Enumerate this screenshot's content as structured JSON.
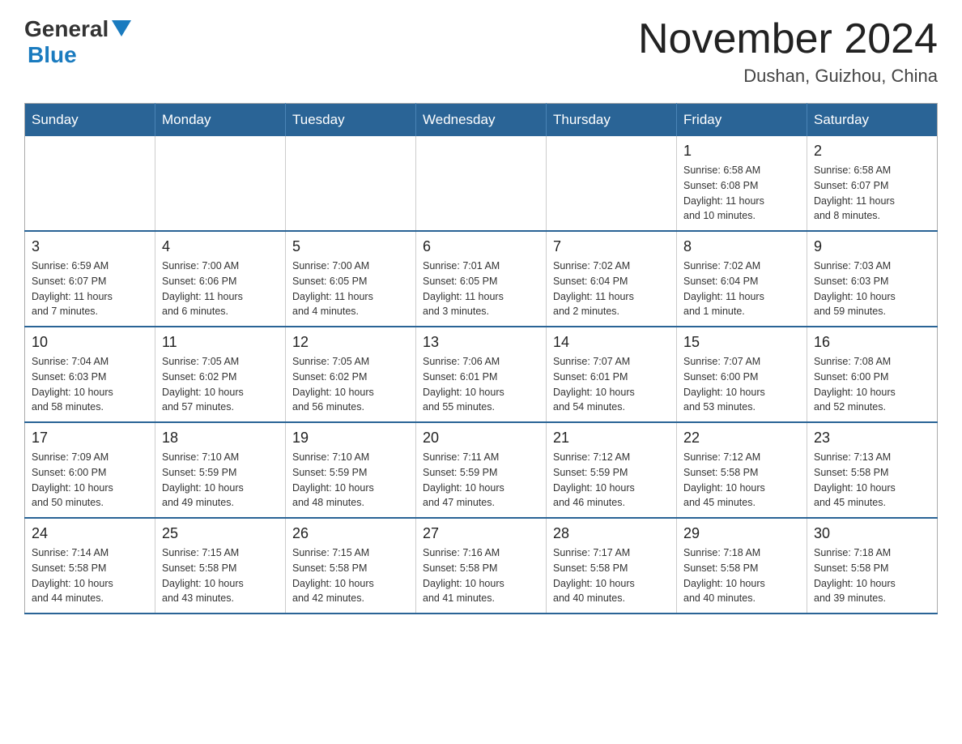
{
  "header": {
    "logo_general": "General",
    "logo_blue": "Blue",
    "month_title": "November 2024",
    "location": "Dushan, Guizhou, China"
  },
  "weekdays": [
    "Sunday",
    "Monday",
    "Tuesday",
    "Wednesday",
    "Thursday",
    "Friday",
    "Saturday"
  ],
  "weeks": [
    [
      {
        "day": "",
        "info": ""
      },
      {
        "day": "",
        "info": ""
      },
      {
        "day": "",
        "info": ""
      },
      {
        "day": "",
        "info": ""
      },
      {
        "day": "",
        "info": ""
      },
      {
        "day": "1",
        "info": "Sunrise: 6:58 AM\nSunset: 6:08 PM\nDaylight: 11 hours\nand 10 minutes."
      },
      {
        "day": "2",
        "info": "Sunrise: 6:58 AM\nSunset: 6:07 PM\nDaylight: 11 hours\nand 8 minutes."
      }
    ],
    [
      {
        "day": "3",
        "info": "Sunrise: 6:59 AM\nSunset: 6:07 PM\nDaylight: 11 hours\nand 7 minutes."
      },
      {
        "day": "4",
        "info": "Sunrise: 7:00 AM\nSunset: 6:06 PM\nDaylight: 11 hours\nand 6 minutes."
      },
      {
        "day": "5",
        "info": "Sunrise: 7:00 AM\nSunset: 6:05 PM\nDaylight: 11 hours\nand 4 minutes."
      },
      {
        "day": "6",
        "info": "Sunrise: 7:01 AM\nSunset: 6:05 PM\nDaylight: 11 hours\nand 3 minutes."
      },
      {
        "day": "7",
        "info": "Sunrise: 7:02 AM\nSunset: 6:04 PM\nDaylight: 11 hours\nand 2 minutes."
      },
      {
        "day": "8",
        "info": "Sunrise: 7:02 AM\nSunset: 6:04 PM\nDaylight: 11 hours\nand 1 minute."
      },
      {
        "day": "9",
        "info": "Sunrise: 7:03 AM\nSunset: 6:03 PM\nDaylight: 10 hours\nand 59 minutes."
      }
    ],
    [
      {
        "day": "10",
        "info": "Sunrise: 7:04 AM\nSunset: 6:03 PM\nDaylight: 10 hours\nand 58 minutes."
      },
      {
        "day": "11",
        "info": "Sunrise: 7:05 AM\nSunset: 6:02 PM\nDaylight: 10 hours\nand 57 minutes."
      },
      {
        "day": "12",
        "info": "Sunrise: 7:05 AM\nSunset: 6:02 PM\nDaylight: 10 hours\nand 56 minutes."
      },
      {
        "day": "13",
        "info": "Sunrise: 7:06 AM\nSunset: 6:01 PM\nDaylight: 10 hours\nand 55 minutes."
      },
      {
        "day": "14",
        "info": "Sunrise: 7:07 AM\nSunset: 6:01 PM\nDaylight: 10 hours\nand 54 minutes."
      },
      {
        "day": "15",
        "info": "Sunrise: 7:07 AM\nSunset: 6:00 PM\nDaylight: 10 hours\nand 53 minutes."
      },
      {
        "day": "16",
        "info": "Sunrise: 7:08 AM\nSunset: 6:00 PM\nDaylight: 10 hours\nand 52 minutes."
      }
    ],
    [
      {
        "day": "17",
        "info": "Sunrise: 7:09 AM\nSunset: 6:00 PM\nDaylight: 10 hours\nand 50 minutes."
      },
      {
        "day": "18",
        "info": "Sunrise: 7:10 AM\nSunset: 5:59 PM\nDaylight: 10 hours\nand 49 minutes."
      },
      {
        "day": "19",
        "info": "Sunrise: 7:10 AM\nSunset: 5:59 PM\nDaylight: 10 hours\nand 48 minutes."
      },
      {
        "day": "20",
        "info": "Sunrise: 7:11 AM\nSunset: 5:59 PM\nDaylight: 10 hours\nand 47 minutes."
      },
      {
        "day": "21",
        "info": "Sunrise: 7:12 AM\nSunset: 5:59 PM\nDaylight: 10 hours\nand 46 minutes."
      },
      {
        "day": "22",
        "info": "Sunrise: 7:12 AM\nSunset: 5:58 PM\nDaylight: 10 hours\nand 45 minutes."
      },
      {
        "day": "23",
        "info": "Sunrise: 7:13 AM\nSunset: 5:58 PM\nDaylight: 10 hours\nand 45 minutes."
      }
    ],
    [
      {
        "day": "24",
        "info": "Sunrise: 7:14 AM\nSunset: 5:58 PM\nDaylight: 10 hours\nand 44 minutes."
      },
      {
        "day": "25",
        "info": "Sunrise: 7:15 AM\nSunset: 5:58 PM\nDaylight: 10 hours\nand 43 minutes."
      },
      {
        "day": "26",
        "info": "Sunrise: 7:15 AM\nSunset: 5:58 PM\nDaylight: 10 hours\nand 42 minutes."
      },
      {
        "day": "27",
        "info": "Sunrise: 7:16 AM\nSunset: 5:58 PM\nDaylight: 10 hours\nand 41 minutes."
      },
      {
        "day": "28",
        "info": "Sunrise: 7:17 AM\nSunset: 5:58 PM\nDaylight: 10 hours\nand 40 minutes."
      },
      {
        "day": "29",
        "info": "Sunrise: 7:18 AM\nSunset: 5:58 PM\nDaylight: 10 hours\nand 40 minutes."
      },
      {
        "day": "30",
        "info": "Sunrise: 7:18 AM\nSunset: 5:58 PM\nDaylight: 10 hours\nand 39 minutes."
      }
    ]
  ]
}
